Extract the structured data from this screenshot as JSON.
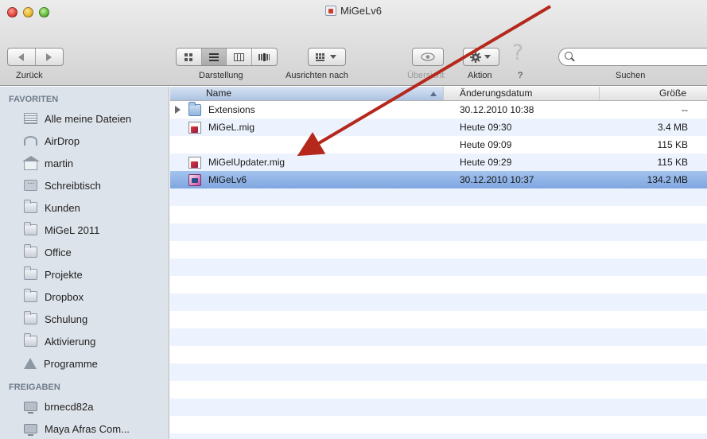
{
  "window": {
    "title": "MiGeLv6"
  },
  "toolbar": {
    "back_label": "Zurück",
    "view_label": "Darstellung",
    "arrange_label": "Ausrichten nach",
    "quicklook_label": "Übersicht",
    "action_label": "Aktion",
    "help_label": "?",
    "help_glyph": "?",
    "search_label": "Suchen",
    "search_value": ""
  },
  "sidebar": {
    "favorites_header": "FAVORITEN",
    "favorites": [
      {
        "label": "Alle meine Dateien",
        "icon": "all-files-icon"
      },
      {
        "label": "AirDrop",
        "icon": "airdrop-icon"
      },
      {
        "label": "martin",
        "icon": "home-icon"
      },
      {
        "label": "Schreibtisch",
        "icon": "desktop-icon"
      },
      {
        "label": "Kunden",
        "icon": "folder-icon"
      },
      {
        "label": "MiGeL 2011",
        "icon": "folder-icon"
      },
      {
        "label": "Office",
        "icon": "folder-icon"
      },
      {
        "label": "Projekte",
        "icon": "folder-icon"
      },
      {
        "label": "Dropbox",
        "icon": "folder-icon"
      },
      {
        "label": "Schulung",
        "icon": "folder-icon"
      },
      {
        "label": "Aktivierung",
        "icon": "folder-icon"
      },
      {
        "label": "Programme",
        "icon": "applications-icon"
      }
    ],
    "shared_header": "FREIGABEN",
    "shared": [
      {
        "label": "brnecd82a",
        "icon": "computer-icon"
      },
      {
        "label": "Maya Afras Com...",
        "icon": "computer-icon"
      }
    ]
  },
  "list": {
    "columns": {
      "name": "Name",
      "date": "Änderungsdatum",
      "size": "Größe"
    },
    "rows": [
      {
        "name": "Extensions",
        "date": "30.12.2010 10:38",
        "size": "--",
        "icon": "folder-icon",
        "selected": false
      },
      {
        "name": "MiGeL.mig",
        "date": "Heute 09:30",
        "size": "3.4 MB",
        "icon": "mig-file-icon",
        "selected": false
      },
      {
        "name": "",
        "date": "Heute 09:09",
        "size": "115 KB",
        "icon": "",
        "selected": false
      },
      {
        "name": "MiGelUpdater.mig",
        "date": "Heute 09:29",
        "size": "115 KB",
        "icon": "mig-file-icon",
        "selected": false
      },
      {
        "name": "MiGeLv6",
        "date": "30.12.2010 10:37",
        "size": "134.2 MB",
        "icon": "app-icon",
        "selected": true
      }
    ]
  },
  "colors": {
    "annotation_arrow": "#b5281c",
    "selection": "#8bb0e5",
    "stripe": "#edf3fe"
  }
}
